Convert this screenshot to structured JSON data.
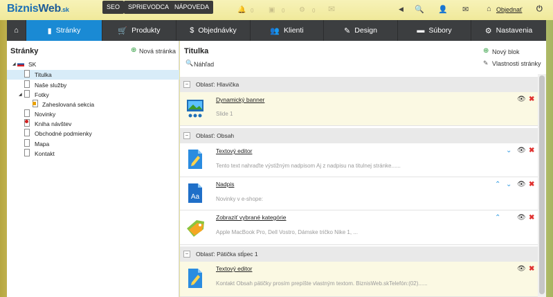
{
  "brand": {
    "part1": "Biznis",
    "part2": "Web",
    "tld": ".sk"
  },
  "top_buttons": [
    "SEO",
    "SPRIEVODCA",
    "NÁPOVEDA"
  ],
  "top_counts": [
    "0",
    "0",
    "0"
  ],
  "top_right": {
    "order_label": "Objednať"
  },
  "nav": [
    {
      "label": "Stránky",
      "icon": "page-icon",
      "active": true
    },
    {
      "label": "Produkty",
      "icon": "cart-icon"
    },
    {
      "label": "Objednávky",
      "icon": "dollar-icon"
    },
    {
      "label": "Klienti",
      "icon": "users-icon"
    },
    {
      "label": "Design",
      "icon": "brush-icon"
    },
    {
      "label": "Súbory",
      "icon": "folder-icon"
    },
    {
      "label": "Nastavenia",
      "icon": "gear-icon"
    }
  ],
  "left": {
    "title": "Stránky",
    "new_page": "Nová stránka",
    "root": "SK",
    "pages": [
      "Titulka",
      "Naše služby",
      "Fotky",
      "Zaheslovaná sekcia",
      "Novinky",
      "Kniha návštev",
      "Obchodné podmienky",
      "Mapa",
      "Kontakt"
    ]
  },
  "right": {
    "title": "Titulka",
    "preview": "Náhľad",
    "new_block": "Nový blok",
    "page_props": "Vlastnosti stránky",
    "areas": [
      {
        "label": "Oblasť: Hlavička",
        "blocks": [
          {
            "title": "Dynamický banner",
            "desc": "Slide 1",
            "icon": "banner-icon"
          }
        ]
      },
      {
        "label": "Oblasť: Obsah",
        "blocks": [
          {
            "title": "Textový editor",
            "desc": "Tento text nahraďte výstižným nadpisom Aj z nadpisu na titulnej stránke......",
            "icon": "text-editor-icon"
          },
          {
            "title": "Nadpis",
            "desc": "Novinky v e-shope:",
            "icon": "heading-icon",
            "icon_text": "Aa"
          },
          {
            "title": "Zobraziť vybrané kategórie",
            "desc": "Apple MacBook Pro, Dell Vostro, Dámske tričko Nike 1, ...",
            "icon": "tag-icon"
          }
        ]
      },
      {
        "label": "Oblasť: Pätička stĺpec 1",
        "blocks": [
          {
            "title": "Textový editor",
            "desc": "Kontakt Obsah pätičky prosím prepíšte vlastným textom. BiznisWeb.skTelefón:(02)......",
            "icon": "text-editor-icon"
          }
        ]
      }
    ]
  },
  "colors": {
    "nav_bg": "#3c3e40",
    "nav_active": "#1a8ad4",
    "delete": "#e0312f",
    "arrow": "#2f9ae2",
    "yellow_row": "#fbf9e3"
  }
}
